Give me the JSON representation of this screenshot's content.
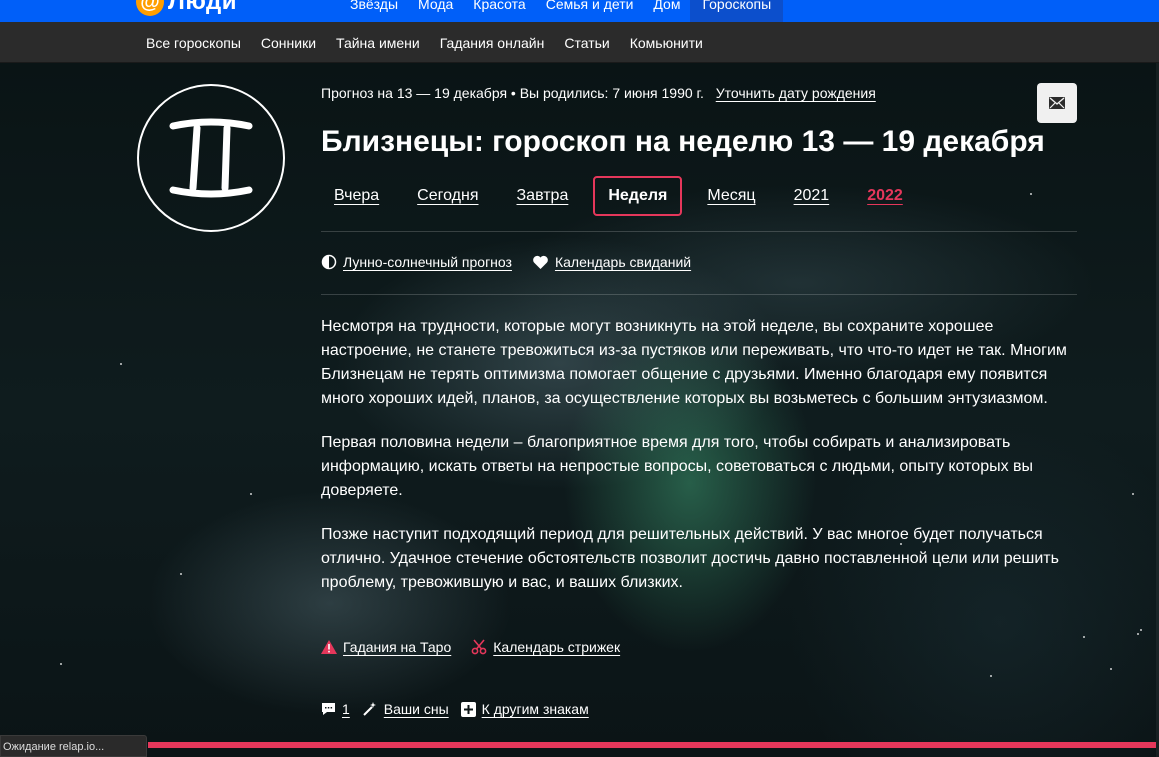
{
  "topbar": {
    "logo_text": "Люди",
    "nav": [
      "Звёзды",
      "Мода",
      "Красота",
      "Семья и дети",
      "Дом",
      "Гороскопы"
    ],
    "active": "Гороскопы"
  },
  "subnav": [
    "Все гороскопы",
    "Сонники",
    "Тайна имени",
    "Гадания онлайн",
    "Статьи",
    "Комьюнити"
  ],
  "page": {
    "meta_text": "Прогноз на 13 — 19 декабря • Вы родились: 7 июня 1990 г.",
    "birth_link": "Уточнить дату рождения",
    "title": "Близнецы: гороскоп на неделю 13 — 19 декабря",
    "periods": [
      "Вчера",
      "Сегодня",
      "Завтра",
      "Неделя",
      "Месяц",
      "2021",
      "2022"
    ],
    "active_period": "Неделя",
    "highlight_period": "2022"
  },
  "quicklinks": {
    "lunar": "Лунно-солнечный прогноз",
    "dating": "Календарь свиданий"
  },
  "text": [
    "Несмотря на трудности, которые могут возникнуть на этой неделе, вы сохраните хорошее настроение, не станете тревожиться из-за пустяков или переживать, что что-то идет не так. Многим Близнецам не терять оптимизма помогает общение с друзьями. Именно благодаря ему появится много хороших идей, планов, за осуществление которых вы возьметесь с большим энтузиазмом.",
    "Первая половина недели – благоприятное время для того, чтобы собирать и анализировать информацию, искать ответы на непростые вопросы, советоваться с людьми, опыту которых вы доверяете.",
    "Позже наступит подходящий период для решительных действий. У вас многое будет получаться отлично. Удачное стечение обстоятельств позволит достичь давно поставленной цели или решить проблему, тревожившую и вас, и ваших близких."
  ],
  "bottomlinks": {
    "tarot": "Гадания на Таро",
    "haircut": "Календарь стрижек"
  },
  "actions": {
    "comments": "1",
    "dreams": "Ваши сны",
    "other_signs": "К другим знакам"
  },
  "status_text": "Ожидание relap.io...",
  "colors": {
    "accent": "#e5375b",
    "topbar": "#005ff9",
    "subnav": "#2b2b2b"
  }
}
